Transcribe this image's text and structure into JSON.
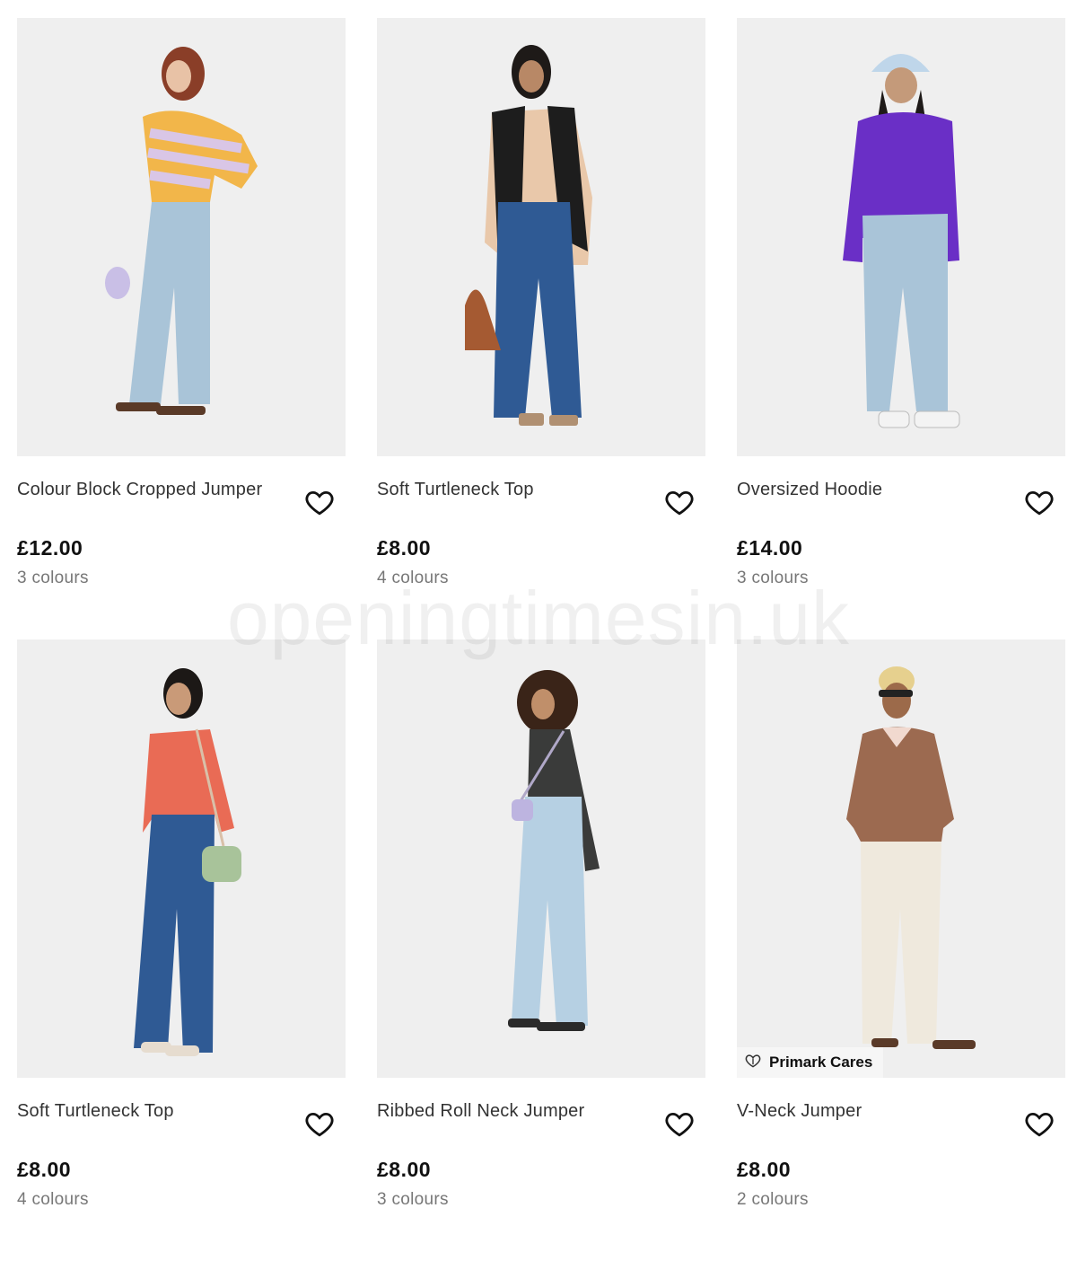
{
  "watermark": "openingtimesin.uk",
  "products": [
    {
      "title": "Colour Block Cropped Jumper",
      "price": "£12.00",
      "colours": "3 colours"
    },
    {
      "title": "Soft Turtleneck Top",
      "price": "£8.00",
      "colours": "4 colours"
    },
    {
      "title": "Oversized Hoodie",
      "price": "£14.00",
      "colours": "3 colours"
    },
    {
      "title": "Soft Turtleneck Top",
      "price": "£8.00",
      "colours": "4 colours"
    },
    {
      "title": "Ribbed Roll Neck Jumper",
      "price": "£8.00",
      "colours": "3 colours"
    },
    {
      "title": "V-Neck Jumper",
      "price": "£8.00",
      "colours": "2 colours",
      "badge": "Primark Cares"
    }
  ],
  "colors": {
    "image_bg": "#efefef",
    "price_text": "#111111",
    "muted_text": "#777777"
  }
}
